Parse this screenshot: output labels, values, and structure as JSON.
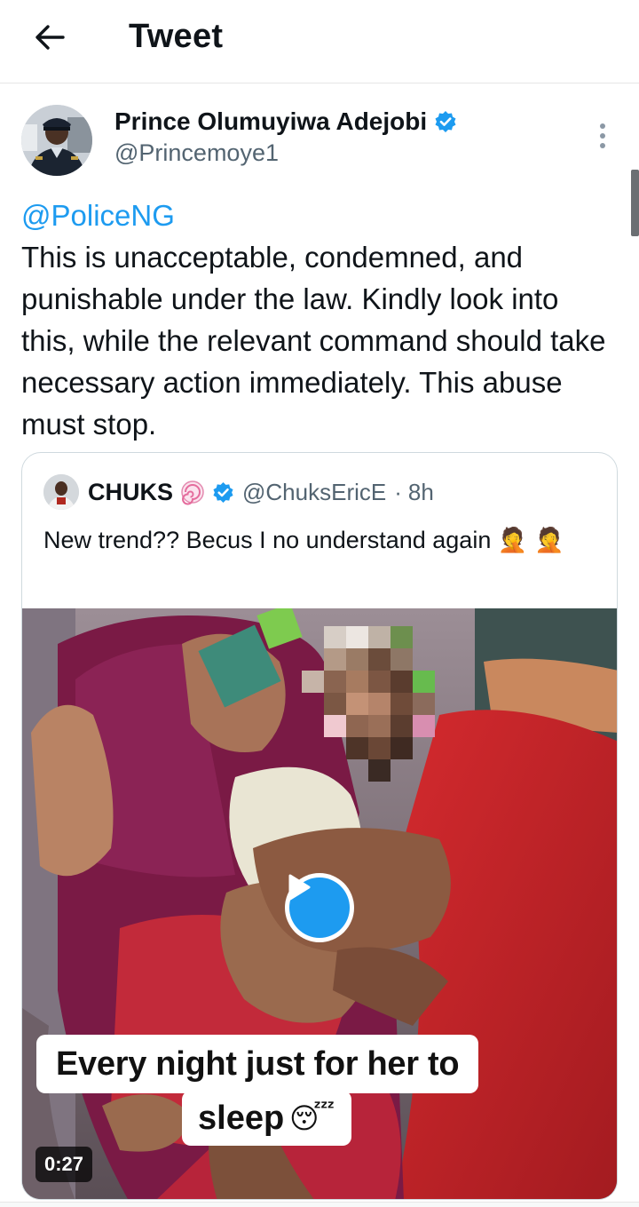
{
  "header": {
    "title": "Tweet",
    "back_icon": "arrow-left-icon"
  },
  "tweet": {
    "author": {
      "name": "Prince Olumuyiwa Adejobi",
      "handle": "@Princemoye1",
      "verified": true
    },
    "mention": "@PoliceNG",
    "text": "This is unacceptable, condemned, and punishable under the law. Kindly look into this, while the relevant command should take necessary action immediately. This abuse must stop."
  },
  "quoted_tweet": {
    "author": {
      "name": "CHUKS",
      "handle": "@ChuksEricE",
      "time": "8h",
      "separator": "·",
      "verified": true,
      "badge_icon": "lollipop-icon"
    },
    "text": "New trend?? Becus I no understand again 🤦 🤦",
    "media": {
      "type": "video",
      "duration": "0:27",
      "caption_line1": "Every night just for her to",
      "caption_line2": "sleep",
      "caption_emoji": "😴",
      "play_icon": "play-icon"
    }
  },
  "colors": {
    "accent": "#1d9bf0",
    "text": "#0f1419",
    "secondary_text": "#536471"
  }
}
